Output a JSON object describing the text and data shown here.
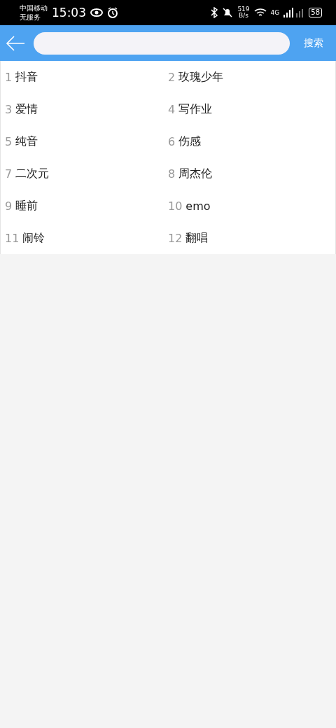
{
  "status_bar": {
    "carrier": "中国移动",
    "service": "无服务",
    "time": "15:03",
    "speed": "519",
    "speed_unit": "B/s",
    "network": "4G",
    "battery": "58"
  },
  "header": {
    "search_button": "搜索"
  },
  "suggestions": [
    {
      "rank": "1",
      "term": "抖音"
    },
    {
      "rank": "2",
      "term": "玫瑰少年"
    },
    {
      "rank": "3",
      "term": "爱情"
    },
    {
      "rank": "4",
      "term": "写作业"
    },
    {
      "rank": "5",
      "term": "纯音"
    },
    {
      "rank": "6",
      "term": "伤感"
    },
    {
      "rank": "7",
      "term": "二次元"
    },
    {
      "rank": "8",
      "term": "周杰伦"
    },
    {
      "rank": "9",
      "term": "睡前"
    },
    {
      "rank": "10",
      "term": "emo"
    },
    {
      "rank": "11",
      "term": "闹铃"
    },
    {
      "rank": "12",
      "term": "翻唱"
    }
  ]
}
